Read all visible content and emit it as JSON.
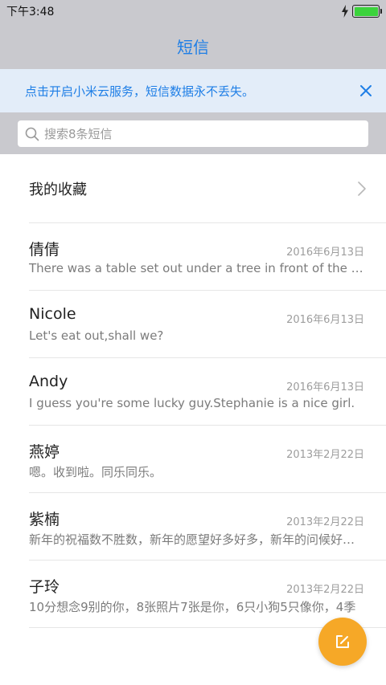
{
  "status_bar": {
    "time": "下午3:48",
    "battery_level": 1.0,
    "icons": [
      "charging-bolt-icon",
      "battery-icon"
    ]
  },
  "nav": {
    "title": "短信"
  },
  "banner": {
    "text": "点击开启小米云服务，短信数据永不丢失。",
    "close_icon": "close-icon"
  },
  "search": {
    "placeholder": "搜索8条短信",
    "icon": "search-icon"
  },
  "favorites": {
    "label": "我的收藏",
    "icon": "chevron-right-icon"
  },
  "conversations": [
    {
      "name": "倩倩",
      "date": "2016年6月13日",
      "preview": "There was a table set out under a tree in front of the house"
    },
    {
      "name": "Nicole",
      "date": "2016年6月13日",
      "preview": "Let's eat out,shall we?"
    },
    {
      "name": "Andy",
      "date": "2016年6月13日",
      "preview": "I guess you're some lucky guy.Stephanie is a nice girl."
    },
    {
      "name": "燕婷",
      "date": "2013年2月22日",
      "preview": "嗯。收到啦。同乐同乐。"
    },
    {
      "name": "紫楠",
      "date": "2013年2月22日",
      "preview": "新年的祝福数不胜数，新年的愿望好多好多，新年的问候好多好多"
    },
    {
      "name": "子玲",
      "date": "2013年2月22日",
      "preview": "10分想念9别的你，8张照片7张是你，6只小狗5只像你，4季"
    }
  ],
  "fab": {
    "icon": "compose-icon"
  },
  "colors": {
    "accent": "#1e7ee6",
    "header_bg": "#c9c9ce",
    "banner_bg": "#e3edf9",
    "fab": "#f6a827",
    "battery": "#3bd33c"
  }
}
